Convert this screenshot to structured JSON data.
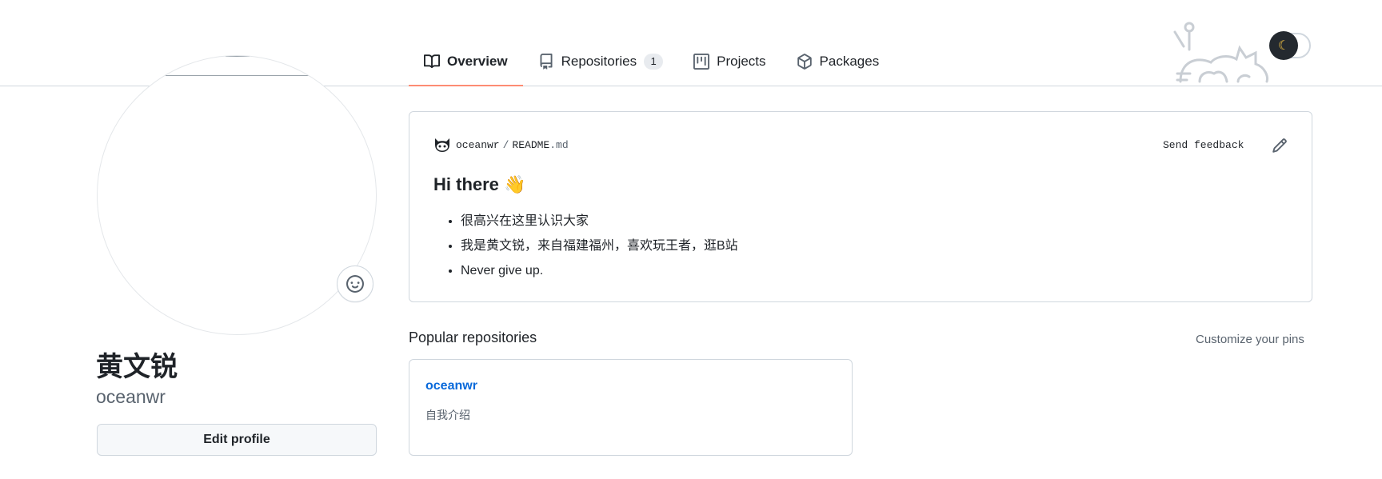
{
  "nav": {
    "tabs": [
      {
        "label": "Overview",
        "icon": "book-icon",
        "selected": true
      },
      {
        "label": "Repositories",
        "icon": "repo-icon",
        "count": "1"
      },
      {
        "label": "Projects",
        "icon": "project-icon"
      },
      {
        "label": "Packages",
        "icon": "package-icon"
      }
    ]
  },
  "profile": {
    "full_name": "黄文锐",
    "username": "oceanwr",
    "edit_label": "Edit profile"
  },
  "readme": {
    "owner": "oceanwr",
    "separator": "/",
    "file_base": "README",
    "file_ext": ".md",
    "feedback_label": "Send feedback",
    "title": "Hi there 👋",
    "items": [
      "很高兴在这里认识大家",
      "我是黄文锐，来自福建福州，喜欢玩王者，逛B站",
      "Never give up."
    ]
  },
  "popular": {
    "title": "Popular repositories",
    "customize_label": "Customize your pins",
    "repos": [
      {
        "name": "oceanwr",
        "description": "自我介绍"
      }
    ]
  },
  "colors": {
    "accent_underline": "#fd8c73",
    "link": "#0969da",
    "border": "#d0d7de"
  }
}
